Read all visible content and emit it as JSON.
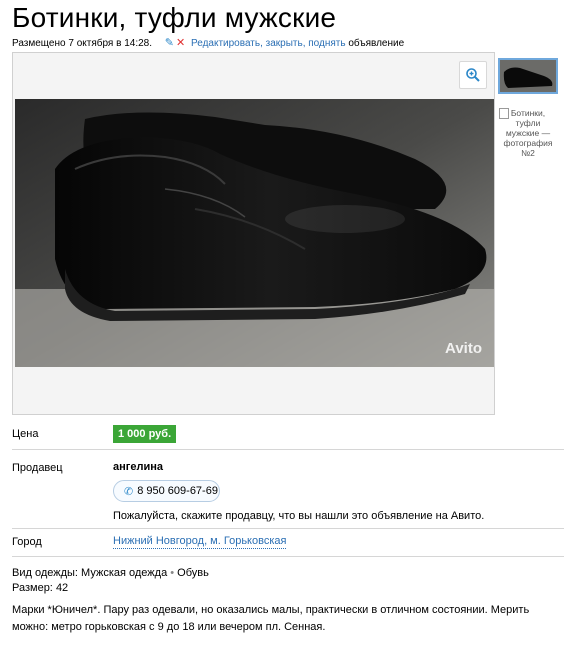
{
  "title": "Ботинки, туфли мужские",
  "meta": {
    "posted": "Размещено 7 октября в 14:28.",
    "edit": "Редактировать",
    "close": "закрыть",
    "raise": "поднять",
    "suffix": "объявление"
  },
  "photo": {
    "watermark": "Avito",
    "thumb2_alt": "Ботинки, туфли мужские — фотография №2"
  },
  "price": {
    "label": "Цена",
    "value": "1 000 руб."
  },
  "seller": {
    "label": "Продавец",
    "name": "ангелина",
    "phone": "8 950 609-67-69",
    "note": "Пожалуйста, скажите продавцу, что вы нашли это объявление на Авито."
  },
  "city": {
    "label": "Город",
    "value": "Нижний Новгород, м. Горьковская"
  },
  "attributes": {
    "clothes_type_label": "Вид одежды:",
    "clothes_type": "Мужская одежда",
    "category": "Обувь",
    "size_label": "Размер:",
    "size": "42"
  },
  "description": "Марки *Юничел*. Пару раз одевали, но оказались малы, практически в отличном состоянии. Мерить можно: метро горьковская с 9 до 18 или вечером пл. Сенная.",
  "colors": {
    "price_bg": "#3ba637",
    "link": "#2b6fb4",
    "delete": "#e03131"
  }
}
